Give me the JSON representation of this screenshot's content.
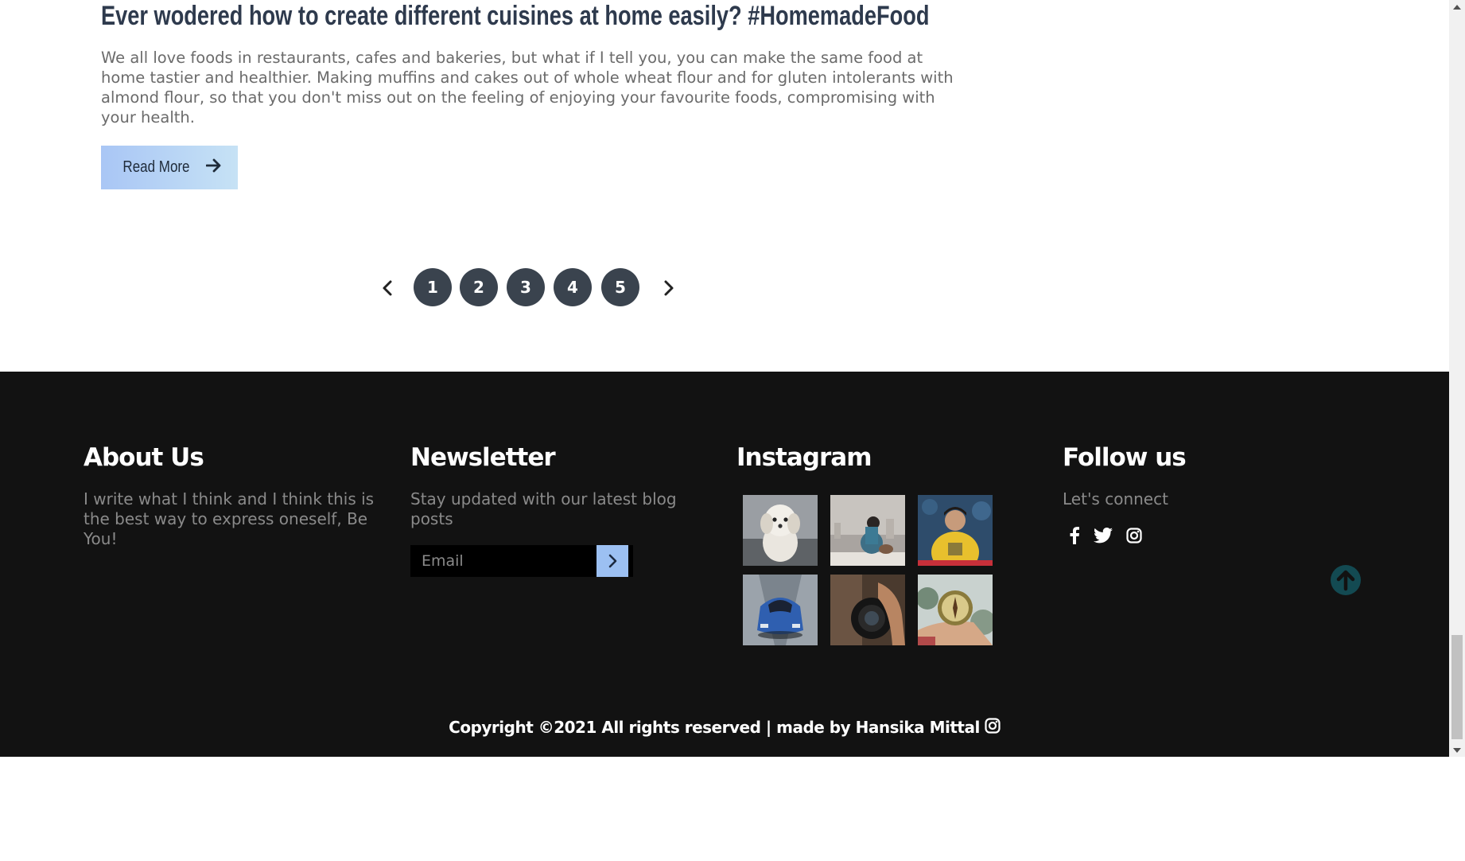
{
  "article": {
    "title": "Ever wodered how to create different cuisines at home easily? #HomemadeFood",
    "excerpt": "We all love foods in restaurants, cafes and bakeries, but what if I tell you, you can make the same food at home tastier and healthier. Making muffins and cakes out of whole wheat flour and for gluten intolerants with almond flour, so that you don't miss out on the feeling of enjoying your favourite foods, compromising with your health.",
    "read_more_label": "Read More",
    "read_more_icon": "arrow-right-icon"
  },
  "pagination": {
    "prev_icon": "chevron-left-icon",
    "pages": [
      "1",
      "2",
      "3",
      "4",
      "5"
    ],
    "next_icon": "chevron-right-icon",
    "color": "#3a434e"
  },
  "footer": {
    "about": {
      "heading": "About Us",
      "text": "I write what I think and I think this is the best way to express oneself, Be You!"
    },
    "newsletter": {
      "heading": "Newsletter",
      "text": "Stay updated with our latest blog posts",
      "email_placeholder": "Email",
      "submit_icon": "chevron-right-icon",
      "submit_color": "#9cc0f2"
    },
    "instagram": {
      "heading": "Instagram",
      "thumbnails": [
        "white-puppy-photo",
        "woman-sitting-city-view-photo",
        "man-yellow-sweater-photo",
        "blue-sports-car-photo",
        "hand-holding-camera-photo",
        "hand-holding-compass-photo"
      ]
    },
    "follow": {
      "heading": "Follow us",
      "text": "Let's connect",
      "icons": [
        "facebook-icon",
        "twitter-icon",
        "instagram-icon"
      ]
    },
    "scroll_top_icon": "arrow-up-circle-icon",
    "scroll_top_color": "#134a52",
    "copyright": "Copyright ©2021 All rights reserved | made by Hansika Mittal",
    "copyright_icon": "instagram-icon",
    "background": "#121212"
  }
}
